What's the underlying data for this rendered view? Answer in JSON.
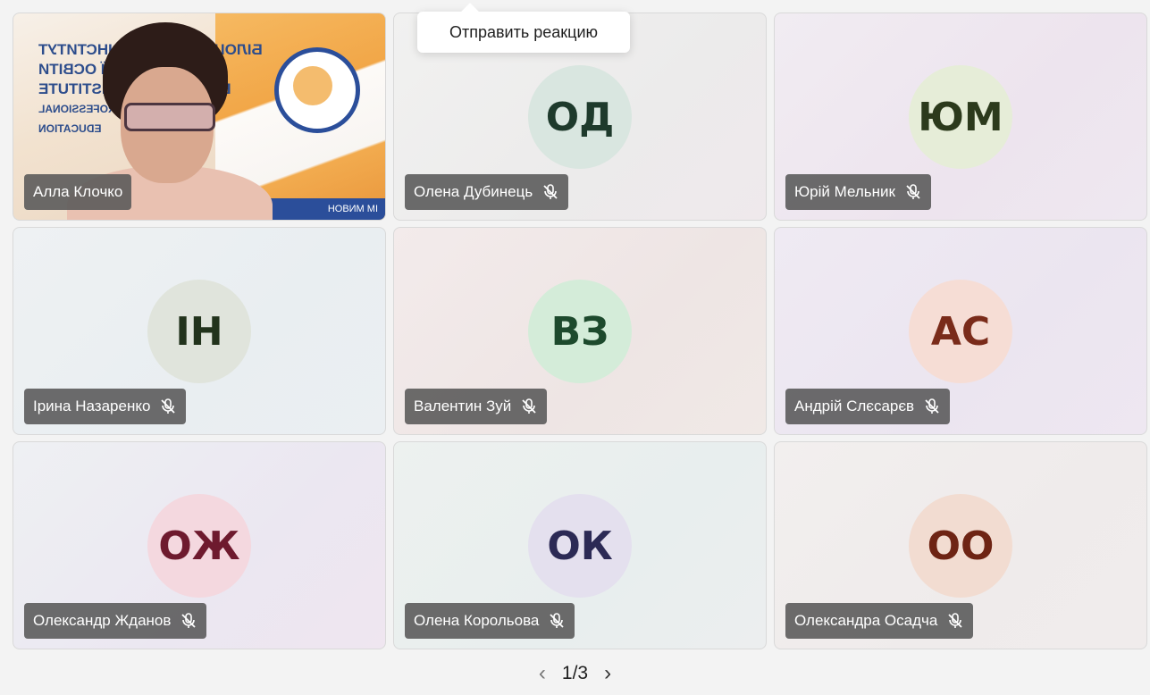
{
  "tooltip": {
    "text": "Отправить реакцию"
  },
  "participants": [
    {
      "name": "Алла Клочко",
      "type": "video",
      "banner_text": [
        "БІЛОЦЕРКІВСЬКИЙ ІНСТИТУТ",
        "НЕПЕРЕРВНОЇ ОСВІТИ",
        "BILA TSERKVA INSTITUTE",
        "OF CONTINUOUS PROFESSIONAL",
        "EDUCATION"
      ],
      "banner_bottom": "НОВИМ МІ"
    },
    {
      "name": "Олена Дубинець",
      "initials": "ОД",
      "avatar_bg": "#d9e6e0",
      "avatar_color": "#1e3a2c",
      "muted": true
    },
    {
      "name": "Юрій Мельник",
      "initials": "ЮМ",
      "avatar_bg": "#e6edd8",
      "avatar_color": "#2c3a1c",
      "muted": true
    },
    {
      "name": "Ірина Назаренко",
      "initials": "ІН",
      "avatar_bg": "#e0e4dc",
      "avatar_color": "#22331c",
      "muted": true
    },
    {
      "name": "Валентин Зуй",
      "initials": "ВЗ",
      "avatar_bg": "#d4ecd9",
      "avatar_color": "#1d4a2d",
      "muted": true
    },
    {
      "name": "Андрій Слєсарєв",
      "initials": "АС",
      "avatar_bg": "#f6ddd5",
      "avatar_color": "#7a2b1a",
      "muted": true
    },
    {
      "name": "Олександр Жданов",
      "initials": "ОЖ",
      "avatar_bg": "#f4d8df",
      "avatar_color": "#6e1a2e",
      "muted": true
    },
    {
      "name": "Олена Корольова",
      "initials": "ОК",
      "avatar_bg": "#e4e0ee",
      "avatar_color": "#2c2a55",
      "muted": true
    },
    {
      "name": "Олександра Осадча",
      "initials": "ОО",
      "avatar_bg": "#f2dcd1",
      "avatar_color": "#6e2414",
      "muted": true
    }
  ],
  "pager": {
    "prev": "‹",
    "page": "1/3",
    "next": "›"
  },
  "icons": {
    "mic_muted": "mic-muted-icon"
  }
}
